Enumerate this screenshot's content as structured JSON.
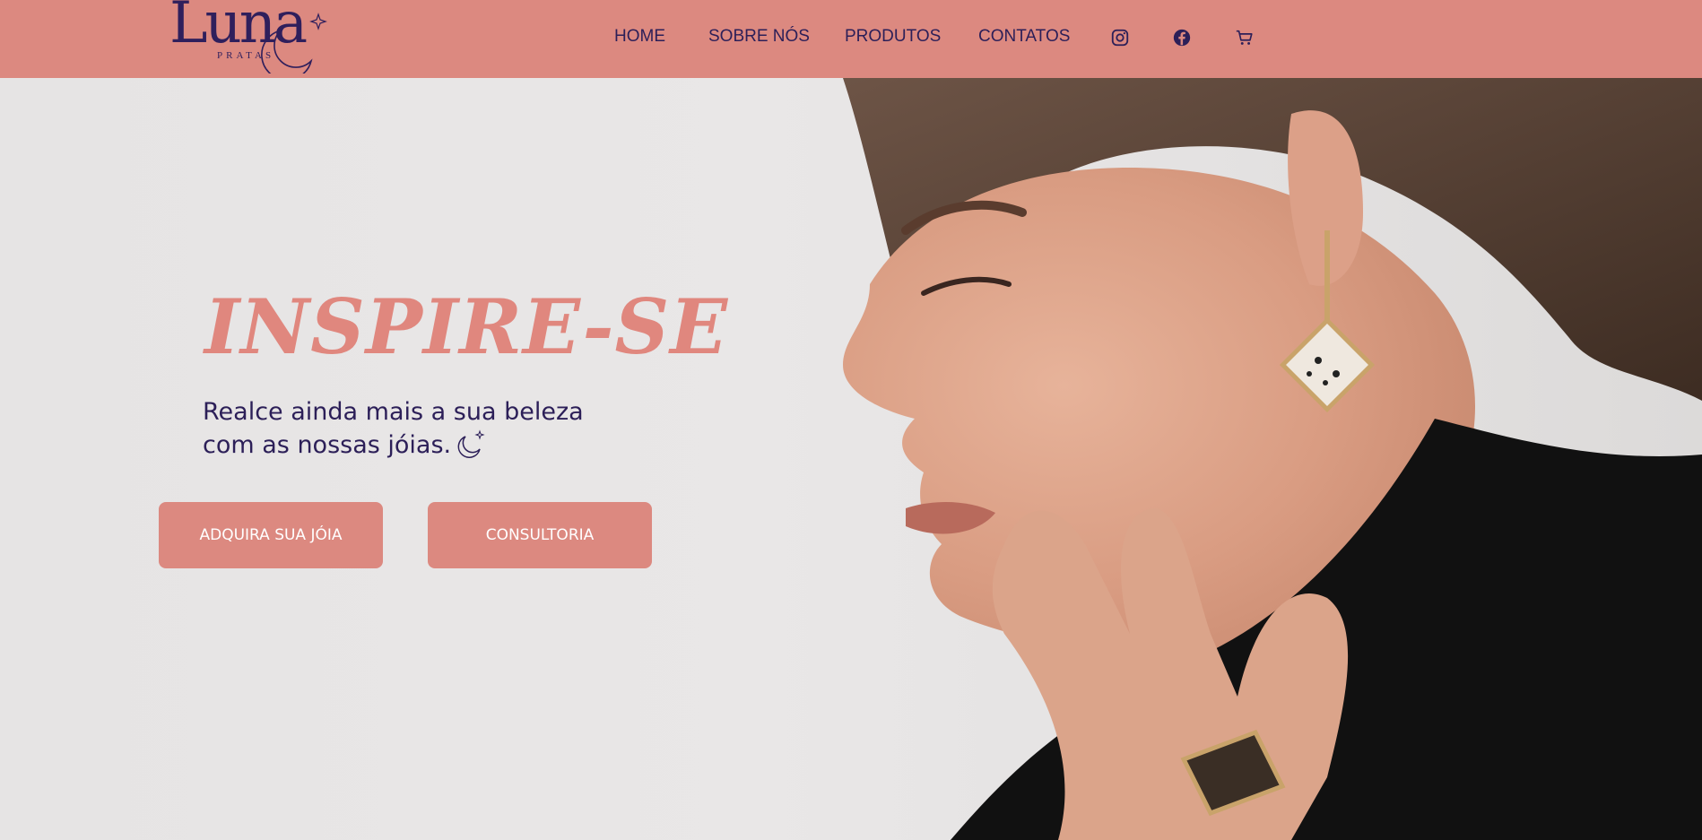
{
  "brand": {
    "name": "Luna",
    "tagline": "PRATAS"
  },
  "nav": {
    "items": [
      {
        "label": "HOME"
      },
      {
        "label": "SOBRE NÓS"
      },
      {
        "label": "PRODUTOS"
      },
      {
        "label": "CONTATOS"
      }
    ],
    "icons": [
      "instagram-icon",
      "facebook-icon",
      "cart-icon"
    ]
  },
  "hero": {
    "headline": "INSPIRE-SE",
    "subtext_line1": "Realce ainda mais a sua beleza",
    "subtext_line2": "com as nossas jóias.",
    "buttons": [
      {
        "label": "ADQUIRA SUA JÓIA"
      },
      {
        "label": "CONSULTORIA"
      }
    ],
    "image_icon": "woman-earring-photo"
  },
  "colors": {
    "topbar": "#dc8980",
    "nav_text": "#2c1f58",
    "headline": "#e0877e",
    "button": "#dc8980",
    "button_text": "#ffffff",
    "background": "#e6e4e4"
  }
}
